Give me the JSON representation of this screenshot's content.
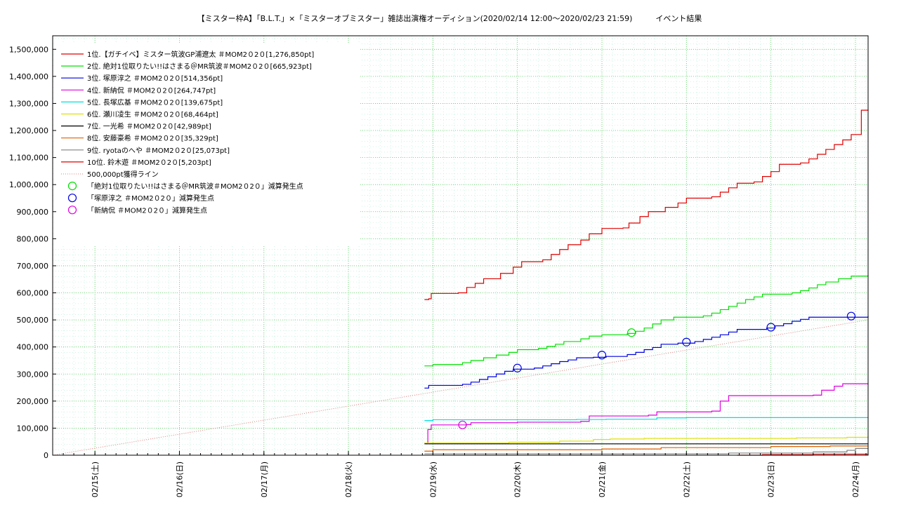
{
  "chart_data": {
    "type": "line",
    "title": "【ミスター枠A】「B.L.T.」×「ミスターオブミスター」雑誌出演権オーディション(2020/02/14 12:00〜2020/02/23 21:59)　　　イベント結果",
    "xlabel": "",
    "ylabel": "",
    "x_range": [
      0,
      7.5
    ],
    "ylim": [
      0,
      1550000
    ],
    "grid": true,
    "legend_placement": "top-left",
    "x_ticks": [
      {
        "x": 0.5,
        "label": "02/15(土)"
      },
      {
        "x": 1.5,
        "label": "02/16(日)"
      },
      {
        "x": 2.5,
        "label": "02/17(月)"
      },
      {
        "x": 3.5,
        "label": "02/18(火)"
      },
      {
        "x": 4.5,
        "label": "02/19(水)"
      },
      {
        "x": 5.5,
        "label": "02/20(木)"
      },
      {
        "x": 6.5,
        "label": "02/21(金)"
      },
      {
        "x": 7.5,
        "label": "02/22(土)"
      },
      {
        "x": 8.5,
        "label": "02/23(日)"
      },
      {
        "x": 9.5,
        "label": "02/24(月)"
      }
    ],
    "y_ticks": [
      0,
      100000,
      200000,
      300000,
      400000,
      500000,
      600000,
      700000,
      800000,
      900000,
      1000000,
      1100000,
      1200000,
      1300000,
      1400000,
      1500000
    ],
    "y_tick_labels": [
      "0",
      "100,000",
      "200,000",
      "300,000",
      "400,000",
      "500,000",
      "600,000",
      "700,000",
      "800,000",
      "900,000",
      "1,000,000",
      "1,100,000",
      "1,200,000",
      "1,300,000",
      "1,400,000",
      "1,500,000"
    ],
    "series": [
      {
        "name": "1位.【ガチイベ】ミスター筑波GP浦遼太 ＃MOM2０2０[1,276,850pt]",
        "color": "#e00000",
        "points": [
          [
            4.4,
            575000
          ],
          [
            4.45,
            578000
          ],
          [
            4.48,
            598000
          ],
          [
            4.8,
            600000
          ],
          [
            4.9,
            620000
          ],
          [
            5.0,
            635000
          ],
          [
            5.1,
            652000
          ],
          [
            5.3,
            672000
          ],
          [
            5.45,
            695000
          ],
          [
            5.55,
            715000
          ],
          [
            5.8,
            722000
          ],
          [
            5.9,
            742000
          ],
          [
            6.0,
            760000
          ],
          [
            6.1,
            778000
          ],
          [
            6.25,
            795000
          ],
          [
            6.35,
            818000
          ],
          [
            6.5,
            838000
          ],
          [
            6.75,
            840000
          ],
          [
            6.82,
            858000
          ],
          [
            6.95,
            882000
          ],
          [
            7.05,
            900000
          ],
          [
            7.25,
            916000
          ],
          [
            7.4,
            932000
          ],
          [
            7.5,
            950000
          ],
          [
            7.8,
            955000
          ],
          [
            7.9,
            972000
          ],
          [
            8.0,
            988000
          ],
          [
            8.1,
            1005000
          ],
          [
            8.3,
            1010000
          ],
          [
            8.4,
            1030000
          ],
          [
            8.5,
            1048000
          ],
          [
            8.6,
            1075000
          ],
          [
            8.85,
            1080000
          ],
          [
            8.95,
            1095000
          ],
          [
            9.05,
            1112000
          ],
          [
            9.15,
            1130000
          ],
          [
            9.25,
            1148000
          ],
          [
            9.35,
            1165000
          ],
          [
            9.45,
            1185000
          ],
          [
            9.57,
            1275000
          ],
          [
            9.65,
            1276850
          ]
        ]
      },
      {
        "name": "2位. 絶対1位取りたい!!はさまる＠MR筑波＃MOM2０2０[665,923pt]",
        "color": "#00e000",
        "points": [
          [
            4.4,
            330000
          ],
          [
            4.5,
            335000
          ],
          [
            4.85,
            342000
          ],
          [
            4.95,
            350000
          ],
          [
            5.1,
            360000
          ],
          [
            5.25,
            370000
          ],
          [
            5.4,
            380000
          ],
          [
            5.5,
            390000
          ],
          [
            5.75,
            395000
          ],
          [
            5.85,
            402000
          ],
          [
            5.95,
            410000
          ],
          [
            6.05,
            420000
          ],
          [
            6.25,
            430000
          ],
          [
            6.35,
            440000
          ],
          [
            6.5,
            445000
          ],
          [
            6.8,
            450000
          ],
          [
            6.9,
            458000
          ],
          [
            7.0,
            470000
          ],
          [
            7.1,
            485000
          ],
          [
            7.2,
            500000
          ],
          [
            7.35,
            510000
          ],
          [
            7.7,
            515000
          ],
          [
            7.8,
            525000
          ],
          [
            7.9,
            538000
          ],
          [
            8.0,
            550000
          ],
          [
            8.1,
            562000
          ],
          [
            8.2,
            575000
          ],
          [
            8.3,
            585000
          ],
          [
            8.4,
            595000
          ],
          [
            8.75,
            600000
          ],
          [
            8.85,
            608000
          ],
          [
            8.95,
            618000
          ],
          [
            9.05,
            630000
          ],
          [
            9.15,
            640000
          ],
          [
            9.3,
            652000
          ],
          [
            9.45,
            662000
          ],
          [
            9.65,
            665923
          ]
        ]
      },
      {
        "name": "3位. 塚原淳之 ＃MOM2０2０[514,356pt]",
        "color": "#0000e0",
        "points": [
          [
            4.4,
            248000
          ],
          [
            4.45,
            258000
          ],
          [
            4.85,
            262000
          ],
          [
            4.95,
            270000
          ],
          [
            5.05,
            280000
          ],
          [
            5.15,
            290000
          ],
          [
            5.25,
            300000
          ],
          [
            5.35,
            310000
          ],
          [
            5.45,
            318000
          ],
          [
            5.7,
            322000
          ],
          [
            5.8,
            330000
          ],
          [
            5.9,
            338000
          ],
          [
            6.0,
            346000
          ],
          [
            6.1,
            352000
          ],
          [
            6.2,
            360000
          ],
          [
            6.4,
            362000
          ],
          [
            6.55,
            365000
          ],
          [
            6.8,
            372000
          ],
          [
            6.9,
            380000
          ],
          [
            7.0,
            390000
          ],
          [
            7.1,
            398000
          ],
          [
            7.2,
            410000
          ],
          [
            7.4,
            414000
          ],
          [
            7.6,
            420000
          ],
          [
            7.7,
            428000
          ],
          [
            7.8,
            436000
          ],
          [
            7.9,
            445000
          ],
          [
            8.0,
            455000
          ],
          [
            8.1,
            465000
          ],
          [
            8.45,
            470000
          ],
          [
            8.55,
            478000
          ],
          [
            8.65,
            486000
          ],
          [
            8.75,
            495000
          ],
          [
            8.85,
            502000
          ],
          [
            8.95,
            510000
          ],
          [
            9.65,
            514356
          ]
        ]
      },
      {
        "name": "4位. 新納侃 ＃MOM2０2０[264,747pt]",
        "color": "#e000e0",
        "points": [
          [
            4.4,
            45000
          ],
          [
            4.44,
            95000
          ],
          [
            4.48,
            112000
          ],
          [
            4.9,
            113000
          ],
          [
            4.95,
            120000
          ],
          [
            5.5,
            122000
          ],
          [
            6.25,
            125000
          ],
          [
            6.35,
            145000
          ],
          [
            7.05,
            148000
          ],
          [
            7.15,
            160000
          ],
          [
            7.8,
            163000
          ],
          [
            7.9,
            200000
          ],
          [
            8.0,
            220000
          ],
          [
            9.0,
            222000
          ],
          [
            9.1,
            240000
          ],
          [
            9.25,
            255000
          ],
          [
            9.35,
            264000
          ],
          [
            9.65,
            264747
          ]
        ]
      },
      {
        "name": "5位. 長塚広基 ＃MOM2０2０[139,675pt]",
        "color": "#00e0e0",
        "points": [
          [
            4.4,
            128000
          ],
          [
            4.5,
            131000
          ],
          [
            6.2,
            132000
          ],
          [
            6.55,
            133000
          ],
          [
            7.15,
            138000
          ],
          [
            7.5,
            139000
          ],
          [
            9.65,
            139675
          ]
        ]
      },
      {
        "name": "6位. 瀬川凌生 ＃MOM2０2０[68,464pt]",
        "color": "#e0e000",
        "points": [
          [
            4.4,
            45000
          ],
          [
            5.4,
            48000
          ],
          [
            6.0,
            52000
          ],
          [
            6.4,
            58000
          ],
          [
            6.6,
            60000
          ],
          [
            7.0,
            62000
          ],
          [
            8.8,
            64000
          ],
          [
            9.4,
            66000
          ],
          [
            9.65,
            68464
          ]
        ]
      },
      {
        "name": "7位. 一光希 ＃MOM2０2０[42,989pt]",
        "color": "#000000",
        "points": [
          [
            4.4,
            42000
          ],
          [
            9.65,
            42989
          ]
        ]
      },
      {
        "name": "8位. 安藤豪希 ＃MOM2０2０[35,329pt]",
        "color": "#e06000",
        "points": [
          [
            4.4,
            15000
          ],
          [
            4.5,
            20000
          ],
          [
            6.5,
            23000
          ],
          [
            7.2,
            28000
          ],
          [
            8.5,
            32000
          ],
          [
            9.2,
            34000
          ],
          [
            9.65,
            35329
          ]
        ]
      },
      {
        "name": "9位. ryotaのへや ＃MOM2０2０[25,073pt]",
        "color": "#808080",
        "points": [
          [
            4.4,
            5000
          ],
          [
            8.0,
            8000
          ],
          [
            9.0,
            12000
          ],
          [
            9.4,
            18000
          ],
          [
            9.5,
            25000
          ],
          [
            9.65,
            25073
          ]
        ]
      },
      {
        "name": "10位. 鈴木遊 ＃MOM2０2０[5,203pt]",
        "color": "#e00000",
        "points": [
          [
            8.1,
            0
          ],
          [
            8.4,
            2000
          ],
          [
            9.0,
            4000
          ],
          [
            9.65,
            5203
          ]
        ]
      }
    ],
    "reference_line": {
      "name": "500,000pt獲得ライン",
      "color": "#e08080",
      "points": [
        [
          0,
          0
        ],
        [
          9.65,
          500000
        ]
      ]
    },
    "markers": [
      {
        "name": "「絶対1位取りたい!!はさまる＠MR筑波＃MOM2０2０」減算発生点",
        "color": "#00e000",
        "points": [
          [
            6.85,
            453000
          ]
        ]
      },
      {
        "name": "「塚原淳之 ＃MOM2０2０」減算発生点",
        "color": "#0000e0",
        "points": [
          [
            5.5,
            322000
          ],
          [
            6.5,
            370000
          ],
          [
            7.5,
            418000
          ],
          [
            8.5,
            473000
          ],
          [
            9.45,
            514000
          ]
        ]
      },
      {
        "name": "「新納侃 ＃MOM2０2０」減算発生点",
        "color": "#e000e0",
        "points": [
          [
            4.85,
            112000
          ]
        ]
      }
    ]
  }
}
